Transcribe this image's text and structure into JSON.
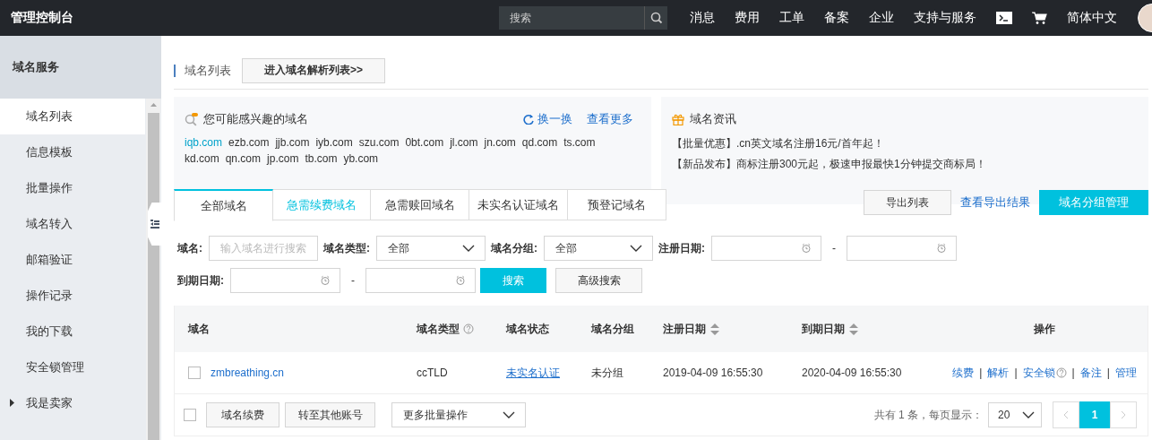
{
  "topbar": {
    "title": "管理控制台",
    "search": {
      "placeholder": "搜索"
    },
    "nav": [
      "消息",
      "费用",
      "工单",
      "备案",
      "企业",
      "支持与服务"
    ],
    "language": "简体中文"
  },
  "sidebar": {
    "header": "域名服务",
    "items": [
      {
        "label": "域名列表",
        "kind": "link",
        "selected": true
      },
      {
        "label": "信息模板",
        "kind": "link",
        "selected": false
      },
      {
        "label": "批量操作",
        "kind": "link",
        "selected": false
      },
      {
        "label": "域名转入",
        "kind": "link",
        "selected": false
      },
      {
        "label": "邮箱验证",
        "kind": "link",
        "selected": false
      },
      {
        "label": "操作记录",
        "kind": "link",
        "selected": false
      },
      {
        "label": "我的下载",
        "kind": "link",
        "selected": false
      },
      {
        "label": "安全锁管理",
        "kind": "link",
        "selected": false
      },
      {
        "label": "我是卖家",
        "kind": "group",
        "selected": false
      }
    ]
  },
  "page_header": {
    "title": "域名列表",
    "button": "进入域名解析列表>>"
  },
  "suggest_card": {
    "title": "您可能感兴趣的域名",
    "refresh": "换一换",
    "more": "查看更多",
    "domains": [
      {
        "name": "iqb.com",
        "highlighted": true
      },
      {
        "name": "ezb.com",
        "highlighted": false
      },
      {
        "name": "jjb.com",
        "highlighted": false
      },
      {
        "name": "iyb.com",
        "highlighted": false
      },
      {
        "name": "szu.com",
        "highlighted": false
      },
      {
        "name": "0bt.com",
        "highlighted": false
      },
      {
        "name": "jl.com",
        "highlighted": false
      },
      {
        "name": "jn.com",
        "highlighted": false
      },
      {
        "name": "qd.com",
        "highlighted": false
      },
      {
        "name": "ts.com",
        "highlighted": false
      },
      {
        "name": "kd.com",
        "highlighted": false
      },
      {
        "name": "qn.com",
        "highlighted": false
      },
      {
        "name": "jp.com",
        "highlighted": false
      },
      {
        "name": "tb.com",
        "highlighted": false
      },
      {
        "name": "yb.com",
        "highlighted": false
      }
    ]
  },
  "news_card": {
    "title": "域名资讯",
    "items": [
      "【批量优惠】.cn英文域名注册16元/首年起！",
      "【新品发布】商标注册300元起，极速申报最快1分钟提交商标局！"
    ]
  },
  "tabs": [
    {
      "label": "全部域名",
      "selected": true,
      "emphasized": false
    },
    {
      "label": "急需续费域名",
      "selected": false,
      "emphasized": true
    },
    {
      "label": "急需赎回域名",
      "selected": false,
      "emphasized": false
    },
    {
      "label": "未实名认证域名",
      "selected": false,
      "emphasized": false
    },
    {
      "label": "预登记域名",
      "selected": false,
      "emphasized": false
    }
  ],
  "actions": {
    "export": "导出列表",
    "export_result": "查看导出结果",
    "group_manage": "域名分组管理"
  },
  "filters": [
    [
      {
        "label": "域名:",
        "kind": "text",
        "placeholder": "输入域名进行搜索"
      },
      {
        "label": "域名类型:",
        "kind": "select",
        "value": "全部"
      },
      {
        "label": "域名分组:",
        "kind": "select",
        "value": "全部"
      },
      {
        "label": "注册日期:",
        "kind": "daterange",
        "separator": "-"
      }
    ],
    [
      {
        "label": "到期日期:",
        "kind": "daterange",
        "separator": "-"
      }
    ]
  ],
  "filter_buttons": {
    "search": "搜索",
    "advanced": "高级搜索"
  },
  "table": {
    "columns": [
      {
        "label": "域名",
        "help": false,
        "sortable": false
      },
      {
        "label": "域名类型",
        "help": true,
        "sortable": false
      },
      {
        "label": "域名状态",
        "help": false,
        "sortable": false
      },
      {
        "label": "域名分组",
        "help": false,
        "sortable": false
      },
      {
        "label": "注册日期",
        "help": false,
        "sortable": true
      },
      {
        "label": "到期日期",
        "help": false,
        "sortable": true
      },
      {
        "label": "操作",
        "help": false,
        "sortable": false
      }
    ],
    "rows": [
      {
        "checked": false,
        "domain": "zmbreathing.cn",
        "type": "ccTLD",
        "status": "未实名认证",
        "group": "未分组",
        "registered": "2019-04-09 16:55:30",
        "expires": "2020-04-09 16:55:30",
        "actions": [
          {
            "label": "续费",
            "help": false
          },
          {
            "label": "解析",
            "help": false,
            "separator": "|"
          },
          {
            "label": "安全锁",
            "help": true,
            "separator": "|"
          },
          {
            "label": "备注",
            "help": false,
            "separator": "|"
          },
          {
            "label": "管理",
            "help": false,
            "separator": "|"
          }
        ]
      }
    ]
  },
  "footer": {
    "checked": false,
    "buttons": [
      "域名续费",
      "转至其他账号"
    ],
    "batch": "更多批量操作",
    "summary": "共有 1 条，每页显示：",
    "page_size": "20",
    "pages": [
      {
        "label": "1",
        "selected": true
      }
    ]
  }
}
